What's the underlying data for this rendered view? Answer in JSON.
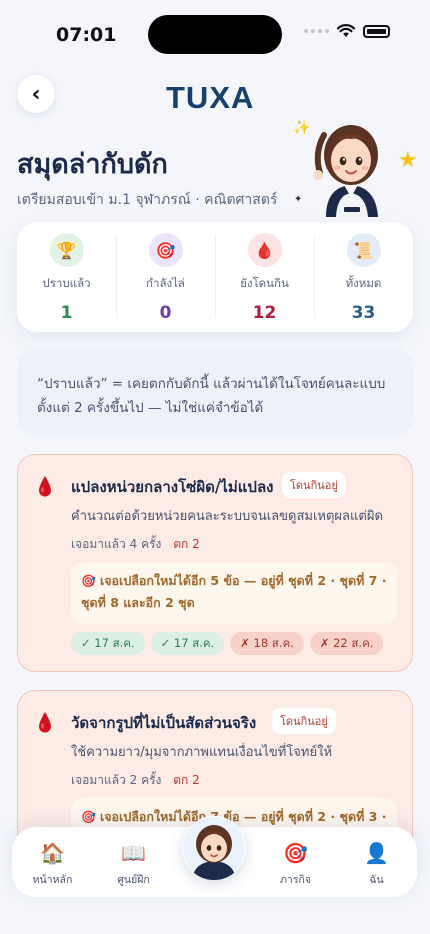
{
  "status_bar": {
    "time": "07:01"
  },
  "header": {
    "back_icon": "‹",
    "logo": "TUXA"
  },
  "page": {
    "title": "สมุดล่ากับดัก",
    "subtitle": "เตรียมสอบเข้า ม.1 จุฬาภรณ์ · คณิตศาสตร์"
  },
  "stats": [
    {
      "icon": "trophy-icon",
      "glyph": "🏆",
      "label": "ปราบแล้ว",
      "value": "1",
      "color": "#2e8b57",
      "bg": "#e2f3e6"
    },
    {
      "icon": "target-icon",
      "glyph": "🎯",
      "label": "กำลังไล่",
      "value": "0",
      "color": "#6b3fa0",
      "bg": "#ece4f8"
    },
    {
      "icon": "blood-drop-icon",
      "glyph": "🩸",
      "label": "ยังโดนกิน",
      "value": "12",
      "color": "#b01e3c",
      "bg": "#fde3e6"
    },
    {
      "icon": "scroll-icon",
      "glyph": "📜",
      "label": "ทั้งหมด",
      "value": "33",
      "color": "#2c5d8f",
      "bg": "#e3ecf7"
    }
  ],
  "note": {
    "line1": "“ปราบแล้ว” = เคยตกกับดักนี้ แล้วผ่านได้ในโจทย์คนละแบบ",
    "line2": "ตั้งแต่ 2 ครั้งขึ้นไป — ไม่ใช่แค่จำข้อได้"
  },
  "traps": [
    {
      "title": "แปลงหน่วยกลางโซ่ผิด/ไม่แปลง",
      "badge": "โดนกินอยู่",
      "desc": "คำนวณต่อด้วยหน่วยคนละระบบจนเลขดูสมเหตุผลแต่ผิด",
      "met": "เจอมาแล้ว 4 ครั้ง",
      "missed": "ตก 2",
      "hint_line1": "เจอเปลือกใหม่ได้อีก 5 ข้อ — อยู่ที่ ชุดที่ 2 · ชุดที่ 7 ·",
      "hint_line2": "ชุดที่ 8 และอีก 2 ชุด",
      "attempts": [
        {
          "label": "✓ 17 ส.ค.",
          "ok": true
        },
        {
          "label": "✓ 17 ส.ค.",
          "ok": true
        },
        {
          "label": "✗ 18 ส.ค.",
          "ok": false
        },
        {
          "label": "✗ 22 ส.ค.",
          "ok": false
        }
      ]
    },
    {
      "title": "วัดจากรูปที่ไม่เป็นสัดส่วนจริง",
      "badge": "โดนกินอยู่",
      "desc": "ใช้ความยาว/มุมจากภาพแทนเงื่อนไขที่โจทย์ให้",
      "met": "เจอมาแล้ว 2 ครั้ง",
      "missed": "ตก 2",
      "hint_line1": "เจอเปลือกใหม่ได้อีก 7 ข้อ — อยู่ที่ ชุดที่ 2 · ชุดที่ 3 ·"
    }
  ],
  "tabbar": [
    {
      "icon": "home-icon",
      "glyph": "🏠",
      "label": "หน้าหลัก"
    },
    {
      "icon": "book-icon",
      "glyph": "📖",
      "label": "ศูนย์ฝึก"
    },
    {
      "icon": "mascot-icon",
      "glyph": "",
      "label": ""
    },
    {
      "icon": "target-icon",
      "glyph": "🎯",
      "label": "ภารกิจ"
    },
    {
      "icon": "user-icon",
      "glyph": "👤",
      "label": "ฉัน"
    }
  ]
}
